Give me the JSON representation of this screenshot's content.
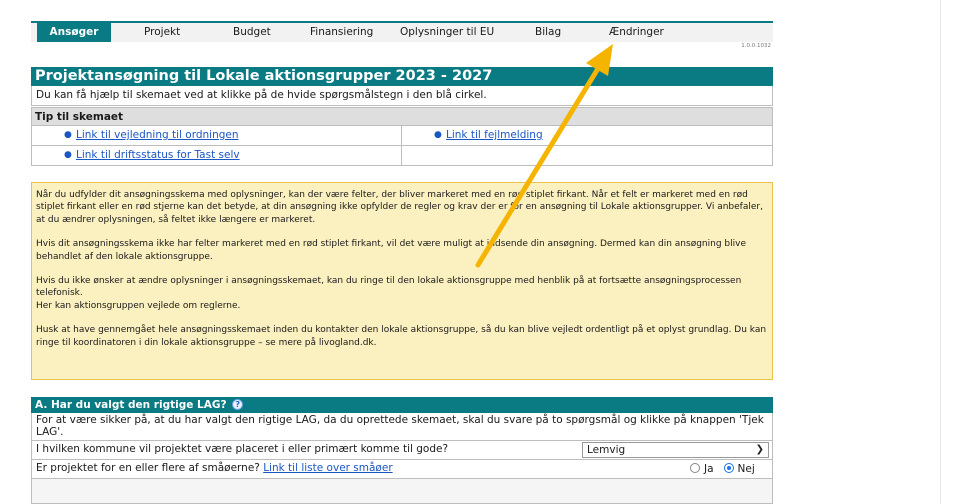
{
  "tabs": [
    {
      "label": "Ansøger",
      "active": true
    },
    {
      "label": "Projekt",
      "active": false
    },
    {
      "label": "Budget",
      "active": false
    },
    {
      "label": "Finansiering",
      "active": false
    },
    {
      "label": "Oplysninger til EU",
      "active": false
    },
    {
      "label": "Bilag",
      "active": false
    },
    {
      "label": "Ændringer",
      "active": false
    }
  ],
  "version": "1.0.0.1032",
  "title": "Projektansøgning til Lokale aktionsgrupper 2023 - 2027",
  "help_text": "Du kan få hjælp til skemaet ved at klikke på de hvide spørgsmålstegn i den blå cirkel.",
  "tips": {
    "header": "Tip til skemaet",
    "links": [
      "Link til vejledning til ordningen",
      "Link til fejlmelding",
      "Link til driftsstatus for Tast selv"
    ]
  },
  "notice": [
    "Når du udfylder dit ansøgningsskema med oplysninger, kan der være felter, der bliver markeret med en rød stiplet firkant. Når et felt er markeret med en rød stiplet firkant eller en rød stjerne kan det betyde, at din ansøgning ikke opfylder de regler og krav der er for en ansøgning til Lokale aktionsgrupper. Vi anbefaler, at du ændrer oplysningen, så feltet ikke længere er markeret.",
    "Hvis dit ansøgningsskema ikke har felter markeret med en rød stiplet firkant, vil det være muligt at indsende din ansøgning. Dermed kan din ansøgning blive behandlet af den lokale aktionsgruppe.",
    "Hvis du ikke ønsker at ændre oplysninger i ansøgningsskemaet, kan du ringe til den lokale aktionsgruppe med henblik på at fortsætte ansøgningsprocessen telefonisk.",
    "Her kan aktionsgruppen vejlede om reglerne.",
    "Husk at have gennemgået hele ansøgningsskemaet inden du kontakter den lokale aktionsgruppe, så du kan blive vejledt ordentligt på et oplyst grundlag. Du kan ringe til koordinatoren i din lokale aktionsgruppe – se mere på livogland.dk."
  ],
  "section_a": {
    "title": "A. Har du valgt den rigtige LAG?",
    "info_icon": "?",
    "intro": "For at være sikker på, at du har valgt den rigtige LAG, da du oprettede skemaet, skal du svare på to spørgsmål og klikke på knappen 'Tjek LAG'.",
    "q1": {
      "label": "I hvilken kommune vil projektet være placeret i eller primært komme til gode?",
      "value": "Lemvig"
    },
    "q2": {
      "label": "Er projektet for en eller flere af småøerne?",
      "link": "Link til liste over småøer",
      "options": [
        "Ja",
        "Nej"
      ],
      "selected": "Nej"
    }
  },
  "annotation": {
    "color": "#f5b400"
  }
}
